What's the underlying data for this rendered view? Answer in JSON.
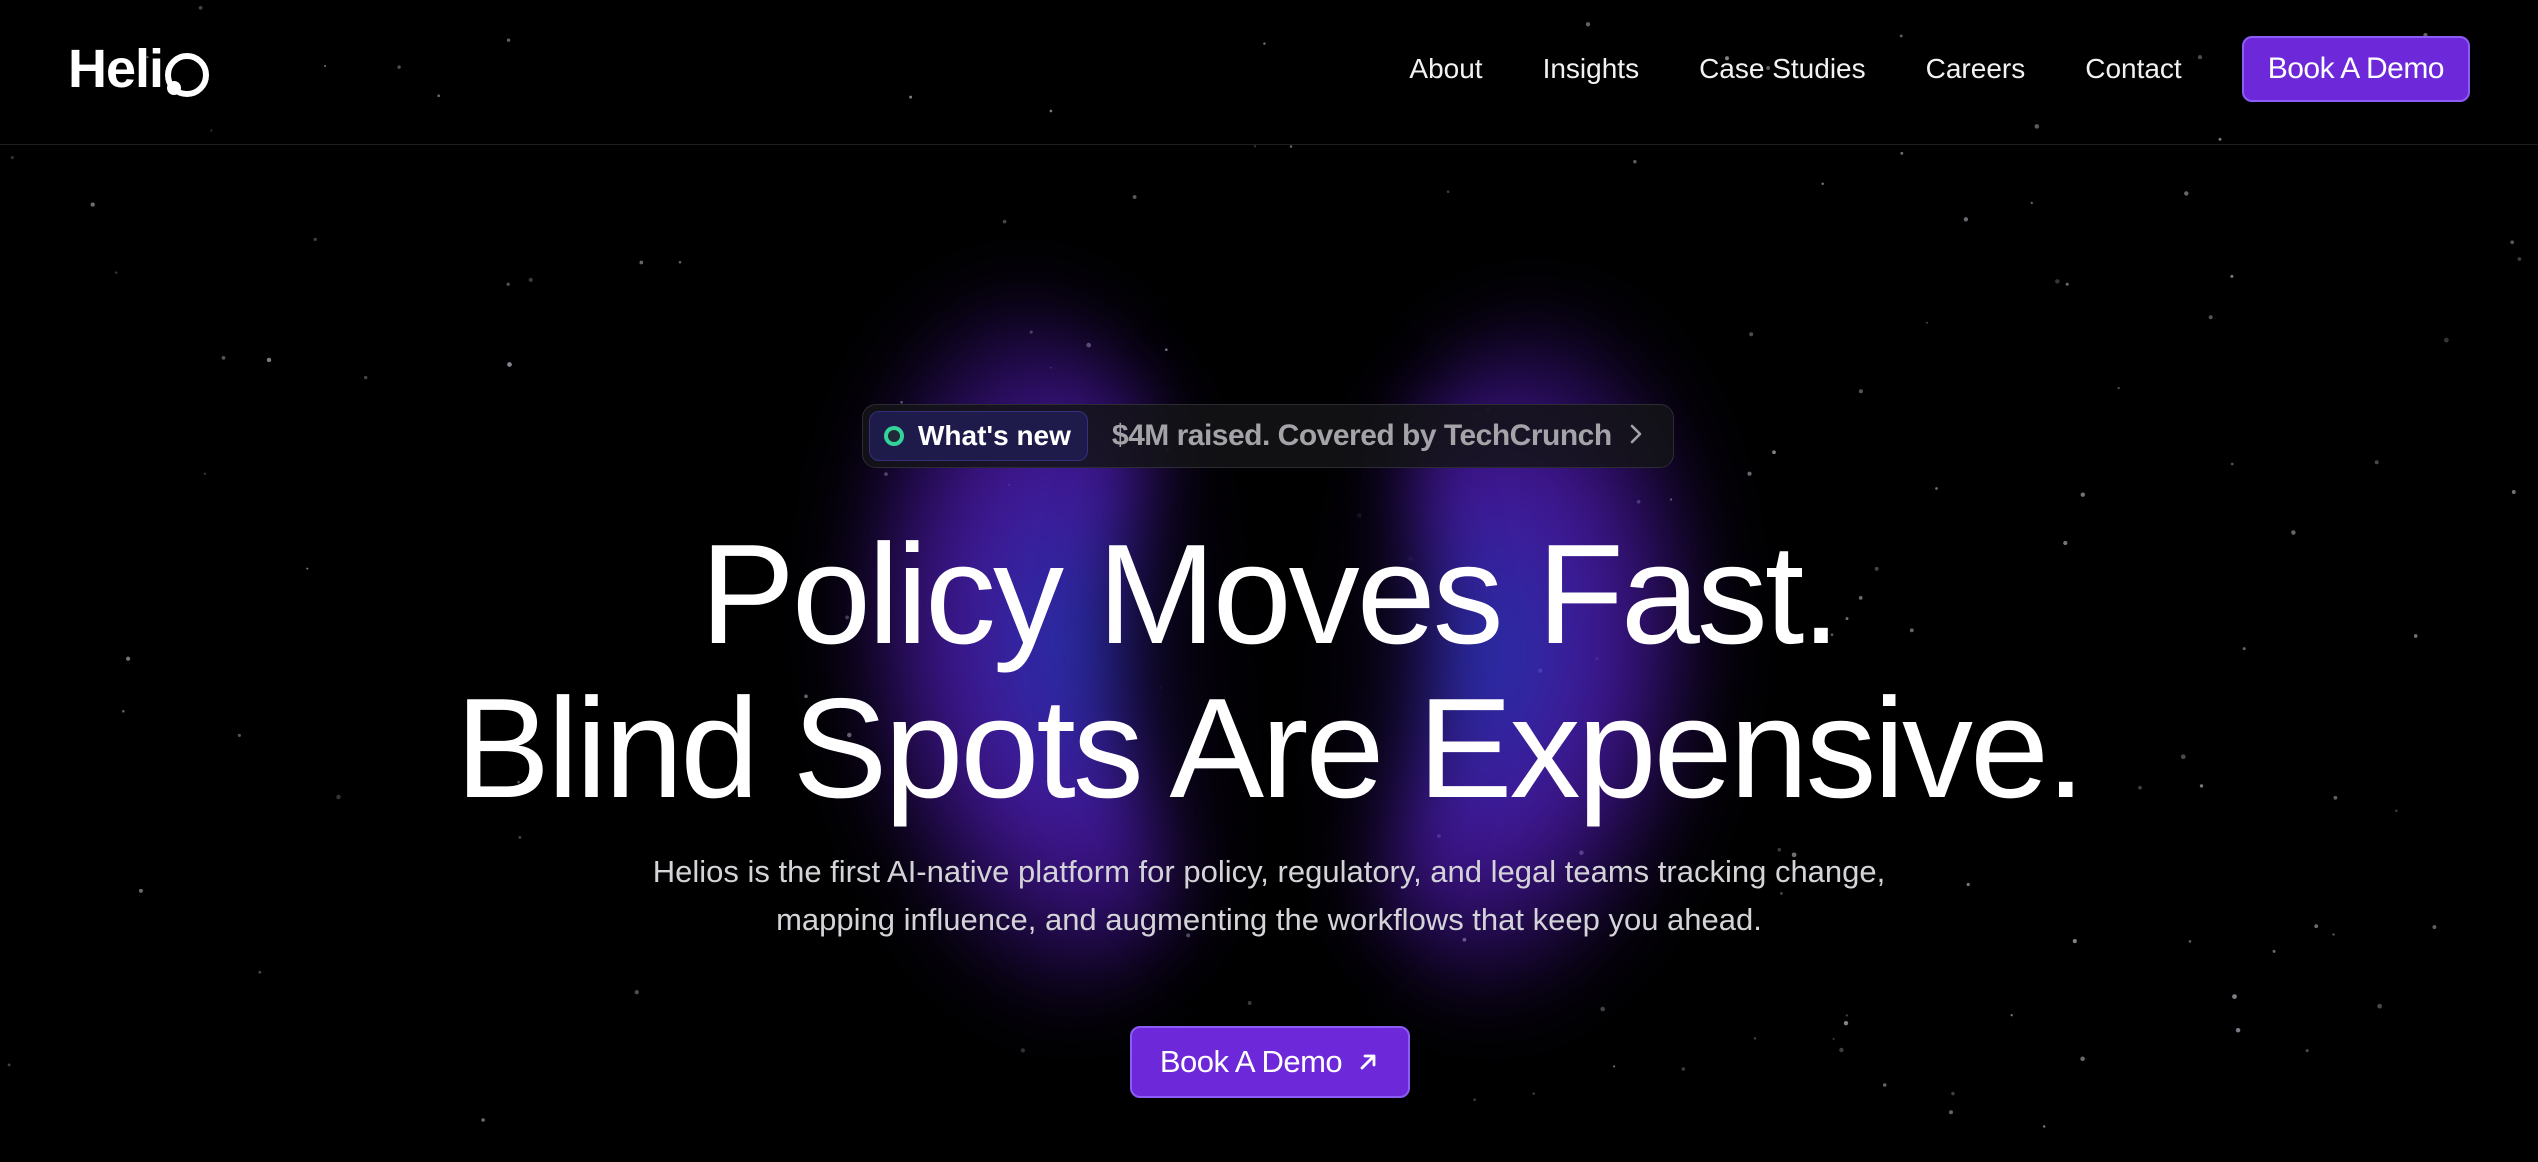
{
  "brand": {
    "name": "Helios",
    "accent_color": "#6d28d9",
    "dot_color": "#34d399"
  },
  "nav": {
    "links": [
      "About",
      "Insights",
      "Case Studies",
      "Careers",
      "Contact"
    ],
    "cta_label": "Book A Demo"
  },
  "announcement": {
    "tag": "What's new",
    "text": "$4M raised. Covered by TechCrunch",
    "icon": "chevron-right-icon"
  },
  "hero": {
    "headline_line1": "Policy Moves Fast.",
    "headline_line2": "Blind Spots Are Expensive.",
    "subtext_line1": "Helios is the first AI-native platform for policy, regulatory, and legal teams tracking change,",
    "subtext_line2": "mapping influence, and augmenting the workflows that keep you ahead.",
    "cta_label": "Book A Demo",
    "cta_icon": "arrow-up-right-icon"
  }
}
